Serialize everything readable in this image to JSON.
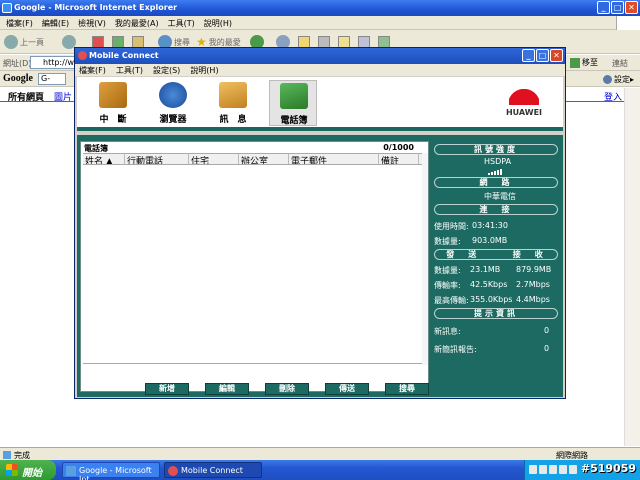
{
  "ie": {
    "title": "Google - Microsoft Internet Explorer",
    "controls": [
      "_",
      "□",
      "✕"
    ],
    "menu": [
      "檔案(F)",
      "編輯(E)",
      "檢視(V)",
      "我的最愛(A)",
      "工具(T)",
      "說明(H)"
    ],
    "toolbar": {
      "back": "上一頁",
      "search": "搜尋",
      "favorites": "我的最愛"
    },
    "address": {
      "label": "網址(D)",
      "value": "http://ww",
      "go": "移至",
      "links": "連結"
    },
    "google": {
      "logo": "Google",
      "box": "G-",
      "settings": "設定▸"
    },
    "page": {
      "tab_all": "所有網頁",
      "tab_images": "圖片",
      "signin": "登入"
    },
    "status": {
      "left": "完成",
      "right": "網際網路"
    }
  },
  "taskbar": {
    "start": "開始",
    "tasks": [
      "Google - Microsoft Int...",
      "Mobile Connect"
    ],
    "watermark": "#519059"
  },
  "mc": {
    "title": "Mobile Connect",
    "menu": [
      "檔案(F)",
      "工具(T)",
      "設定(S)",
      "說明(H)"
    ],
    "toolbar": [
      {
        "label": "中　斷",
        "icon": "disconnect-icon",
        "color": "#c88a2a"
      },
      {
        "label": "瀏覽器",
        "icon": "globe-icon",
        "color": "#2a6ab8"
      },
      {
        "label": "訊　息",
        "icon": "envelope-icon",
        "color": "#d8a030"
      },
      {
        "label": "電話簿",
        "icon": "phonebook-icon",
        "color": "#3a9a3a"
      }
    ],
    "brand": "HUAWEI",
    "phonebook": {
      "title": "電話簿",
      "count": "0/1000",
      "columns": [
        "姓名 ▲",
        "行動電話",
        "住宅",
        "辦公室",
        "電子郵件",
        "備註"
      ],
      "buttons": [
        "新增",
        "編輯",
        "刪除",
        "傳送",
        "搜尋"
      ]
    },
    "side": {
      "signal_header": "訊號強度",
      "network_type": "HSDPA",
      "network_header": "網　路",
      "operator": "中華電信",
      "connect_header": "連　接",
      "usage_time_label": "使用時間:",
      "usage_time": "03:41:30",
      "data_label": "數據量:",
      "data_total": "903.0MB",
      "send_header": "發　送",
      "recv_header": "接　收",
      "data_amount_label": "數據量:",
      "sent": "23.1MB",
      "received": "879.9MB",
      "rate_label": "傳輸率:",
      "rate_up": "42.5Kbps",
      "rate_down": "2.7Mbps",
      "max_label": "最高傳輸:",
      "max_up": "355.0Kbps",
      "max_down": "4.4Mbps",
      "info_header": "提示資訊",
      "new_msg_label": "新訊息:",
      "new_msg": "0",
      "new_report_label": "新簡訊報告:",
      "new_report": "0"
    },
    "colors": {
      "teal": "#1c6a62",
      "titlebar": "#2f66d8"
    }
  }
}
